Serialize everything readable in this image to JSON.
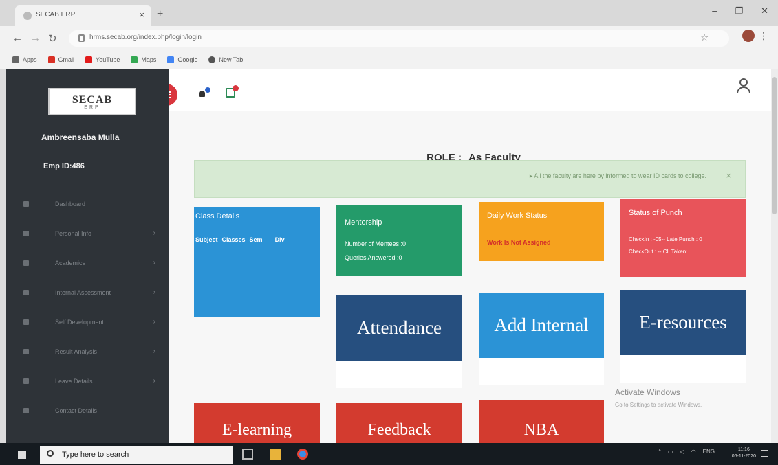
{
  "browser": {
    "tab_title": "SECAB ERP",
    "tab_close": "×",
    "new_tab": "+",
    "controls": [
      "–",
      "❐",
      "✕"
    ],
    "url": "hrms.secab.org/index.php/login/login",
    "bookmarks": [
      {
        "label": "Apps",
        "color": "#666666"
      },
      {
        "label": "Gmail",
        "color": "#d93025"
      },
      {
        "label": "YouTube",
        "color": "#e21b1b"
      },
      {
        "label": "Maps",
        "color": "#34a853"
      },
      {
        "label": "Google",
        "color": "#4285f4"
      },
      {
        "label": "New Tab",
        "color": "#555555"
      }
    ]
  },
  "sidebar": {
    "logo_main": "SECAB",
    "logo_sub": "ERP",
    "user_name": "Ambreensaba Mulla",
    "emp_id": "Emp ID:486",
    "items": [
      {
        "label": "Dashboard",
        "chevron": ""
      },
      {
        "label": "Personal Info",
        "chevron": "›"
      },
      {
        "label": "Academics",
        "chevron": "›"
      },
      {
        "label": "Internal Assessment",
        "chevron": "›"
      },
      {
        "label": "Self Development",
        "chevron": "›"
      },
      {
        "label": "Result Analysis",
        "chevron": "›"
      },
      {
        "label": "Leave Details",
        "chevron": "›"
      },
      {
        "label": "Contact Details",
        "chevron": ""
      }
    ]
  },
  "main": {
    "role_label": "ROLE :",
    "role_value": "As Faculty",
    "alert_text": "All the faculty are here by informed to wear ID cards to college.",
    "alert_close": "×",
    "cards": {
      "class_details": {
        "title": "Class Details",
        "cols": [
          "Subject",
          "Classes",
          "Sem",
          "Div"
        ],
        "color": "#2b93d6"
      },
      "mentorship": {
        "title": "Mentorship",
        "line1": "Number of Mentees :0",
        "line2": "Queries Answered :0",
        "color": "#249b6a"
      },
      "daily_work": {
        "title": "Daily Work Status",
        "line1": "Work Is Not Assigned",
        "color": "#f6a21e"
      },
      "punch": {
        "title": "Status of Punch",
        "line1": "CheckIn : -05-- Late Punch : 0",
        "line2": "CheckOut : -- CL Taken:",
        "color": "#e8545a"
      }
    },
    "tiles": [
      {
        "label": "Attendance",
        "color": "#264f7f"
      },
      {
        "label": "Add Internal",
        "color": "#2b93d6"
      },
      {
        "label": "E-resources",
        "color": "#264f7f"
      }
    ],
    "bottom_tiles": [
      "E-learning",
      "Feedback",
      "NBA"
    ],
    "watermark_title": "Activate Windows",
    "watermark_sub": "Go to Settings to activate Windows."
  },
  "taskbar": {
    "search_placeholder": "Type here to search",
    "tray_lang": "ENG",
    "clock_time": "11:16",
    "clock_date": "06-11-2020"
  }
}
